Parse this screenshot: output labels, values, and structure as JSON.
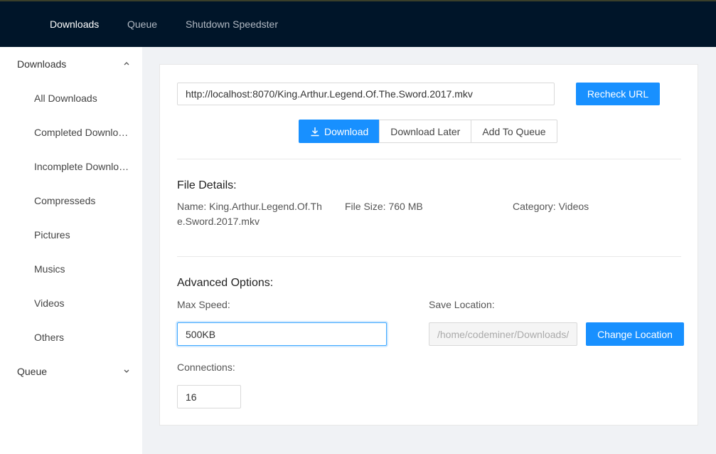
{
  "topnav": {
    "items": [
      {
        "label": "Downloads",
        "active": true
      },
      {
        "label": "Queue",
        "active": false
      },
      {
        "label": "Shutdown Speedster",
        "active": false
      }
    ]
  },
  "sidebar": {
    "downloads_group": "Downloads",
    "items": [
      {
        "label": "All Downloads"
      },
      {
        "label": "Completed Downloads"
      },
      {
        "label": "Incomplete Downloads"
      },
      {
        "label": "Compresseds"
      },
      {
        "label": "Pictures"
      },
      {
        "label": "Musics"
      },
      {
        "label": "Videos"
      },
      {
        "label": "Others"
      }
    ],
    "queue_group": "Queue"
  },
  "form": {
    "url_value": "http://localhost:8070/King.Arthur.Legend.Of.The.Sword.2017.mkv",
    "recheck_label": "Recheck URL",
    "download_label": "Download",
    "download_later_label": "Download Later",
    "add_to_queue_label": "Add To Queue"
  },
  "file_details": {
    "title": "File Details:",
    "name_line1": "Name: King.Arthur.Legend.Of.Th",
    "name_line2": "e.Sword.2017.mkv",
    "size": "File Size: 760 MB",
    "category": "Category: Videos"
  },
  "advanced": {
    "title": "Advanced Options:",
    "max_speed_label": "Max Speed:",
    "max_speed_value": "500KB",
    "save_location_label": "Save Location:",
    "save_location_value": "/home/codeminer/Downloads/",
    "change_location_label": "Change Location",
    "connections_label": "Connections:",
    "connections_value": "16"
  },
  "colors": {
    "header_bg": "#001529",
    "primary": "#1890ff"
  }
}
